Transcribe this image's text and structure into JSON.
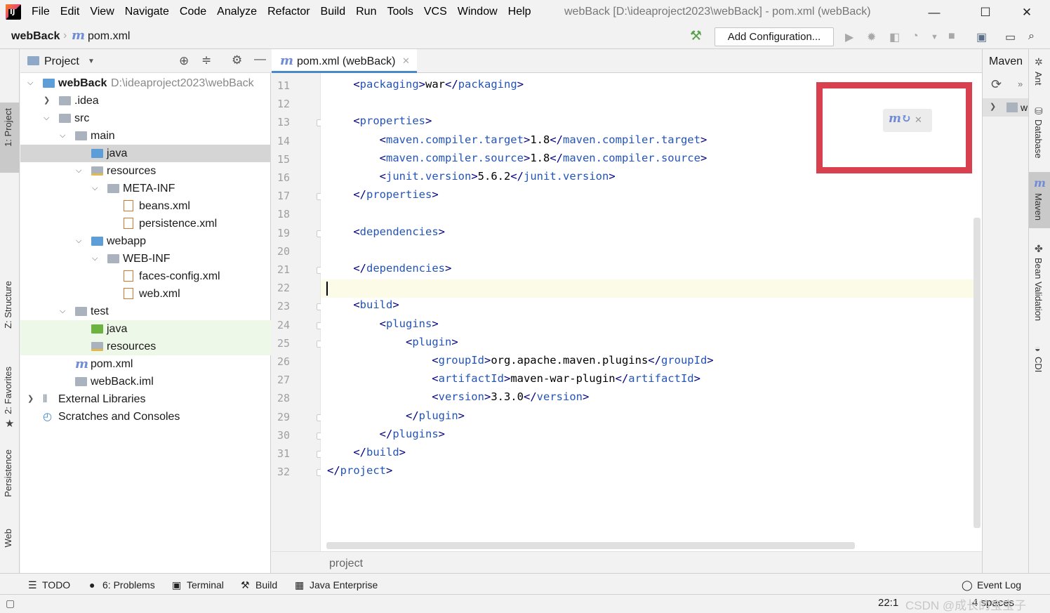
{
  "titlebar": {
    "menu": [
      "File",
      "Edit",
      "View",
      "Navigate",
      "Code",
      "Analyze",
      "Refactor",
      "Build",
      "Run",
      "Tools",
      "VCS",
      "Window",
      "Help"
    ],
    "title": "webBack [D:\\ideaproject2023\\webBack] - pom.xml (webBack)",
    "minimize": "—",
    "maximize": "☐",
    "close": "✕"
  },
  "navbar": {
    "project": "webBack",
    "file": "pom.xml",
    "add_config": "Add Configuration..."
  },
  "left_stripe": {
    "project": "1: Project",
    "structure": "Z: Structure",
    "favorites": "2: Favorites",
    "persistence": "Persistence",
    "web": "Web"
  },
  "project_panel": {
    "title": "Project",
    "tree": [
      {
        "label": "webBack",
        "path": "D:\\ideaproject2023\\webBack"
      },
      {
        "label": ".idea"
      },
      {
        "label": "src"
      },
      {
        "label": "main"
      },
      {
        "label": "java"
      },
      {
        "label": "resources"
      },
      {
        "label": "META-INF"
      },
      {
        "label": "beans.xml"
      },
      {
        "label": "persistence.xml"
      },
      {
        "label": "webapp"
      },
      {
        "label": "WEB-INF"
      },
      {
        "label": "faces-config.xml"
      },
      {
        "label": "web.xml"
      },
      {
        "label": "test"
      },
      {
        "label": "java"
      },
      {
        "label": "resources"
      },
      {
        "label": "pom.xml"
      },
      {
        "label": "webBack.iml"
      },
      {
        "label": "External Libraries"
      },
      {
        "label": "Scratches and Consoles"
      }
    ]
  },
  "editor": {
    "tab": "pom.xml (webBack)",
    "line_numbers": [
      "11",
      "12",
      "13",
      "14",
      "15",
      "16",
      "17",
      "18",
      "19",
      "20",
      "21",
      "22",
      "23",
      "24",
      "25",
      "26",
      "27",
      "28",
      "29",
      "30",
      "31",
      "32"
    ],
    "lines": [
      {
        "pre": "    <",
        "tag": "packaging",
        "mid": ">war</",
        "tag2": "packaging",
        "post": ">"
      },
      {
        "pre": "",
        "tag": "",
        "mid": "",
        "tag2": "",
        "post": ""
      },
      {
        "pre": "    <",
        "tag": "properties",
        "mid": ">",
        "tag2": "",
        "post": ""
      },
      {
        "pre": "        <",
        "tag": "maven.compiler.target",
        "mid": ">1.8</",
        "tag2": "maven.compiler.target",
        "post": ">"
      },
      {
        "pre": "        <",
        "tag": "maven.compiler.source",
        "mid": ">1.8</",
        "tag2": "maven.compiler.source",
        "post": ">"
      },
      {
        "pre": "        <",
        "tag": "junit.version",
        "mid": ">5.6.2</",
        "tag2": "junit.version",
        "post": ">"
      },
      {
        "pre": "    </",
        "tag": "properties",
        "mid": ">",
        "tag2": "",
        "post": ""
      },
      {
        "pre": "",
        "tag": "",
        "mid": "",
        "tag2": "",
        "post": ""
      },
      {
        "pre": "    <",
        "tag": "dependencies",
        "mid": ">",
        "tag2": "",
        "post": ""
      },
      {
        "pre": "",
        "tag": "",
        "mid": "",
        "tag2": "",
        "post": ""
      },
      {
        "pre": "    </",
        "tag": "dependencies",
        "mid": ">",
        "tag2": "",
        "post": ""
      },
      {
        "pre": "",
        "tag": "",
        "mid": "",
        "tag2": "",
        "post": ""
      },
      {
        "pre": "    <",
        "tag": "build",
        "mid": ">",
        "tag2": "",
        "post": ""
      },
      {
        "pre": "        <",
        "tag": "plugins",
        "mid": ">",
        "tag2": "",
        "post": ""
      },
      {
        "pre": "            <",
        "tag": "plugin",
        "mid": ">",
        "tag2": "",
        "post": ""
      },
      {
        "pre": "                <",
        "tag": "groupId",
        "mid": ">org.apache.maven.plugins</",
        "tag2": "groupId",
        "post": ">"
      },
      {
        "pre": "                <",
        "tag": "artifactId",
        "mid": ">maven-war-plugin</",
        "tag2": "artifactId",
        "post": ">"
      },
      {
        "pre": "                <",
        "tag": "version",
        "mid": ">3.3.0</",
        "tag2": "version",
        "post": ">"
      },
      {
        "pre": "            </",
        "tag": "plugin",
        "mid": ">",
        "tag2": "",
        "post": ""
      },
      {
        "pre": "        </",
        "tag": "plugins",
        "mid": ">",
        "tag2": "",
        "post": ""
      },
      {
        "pre": "    </",
        "tag": "build",
        "mid": ">",
        "tag2": "",
        "post": ""
      },
      {
        "pre": "</",
        "tag": "project",
        "mid": ">",
        "tag2": "",
        "post": ""
      }
    ],
    "breadcrumb": "project"
  },
  "maven_panel": {
    "title": "Maven"
  },
  "right_stripe": {
    "ant": "Ant",
    "database": "Database",
    "maven": "Maven",
    "bean_validation": "Bean Validation",
    "cdi": "CDI"
  },
  "bottom_tools": {
    "todo": "TODO",
    "problems": "6: Problems",
    "terminal": "Terminal",
    "build": "Build",
    "java_enterprise": "Java Enterprise",
    "event_log": "Event Log"
  },
  "status": {
    "position": "22:1",
    "indent": "4 spaces",
    "watermark": "CSDN @成长的宝宝子"
  },
  "colors": {
    "tag": "#2354b8",
    "bracket": "#000080",
    "highlight_box": "#d9404f",
    "selection": "#d5d5d5",
    "current_line": "#fcfbe8"
  }
}
